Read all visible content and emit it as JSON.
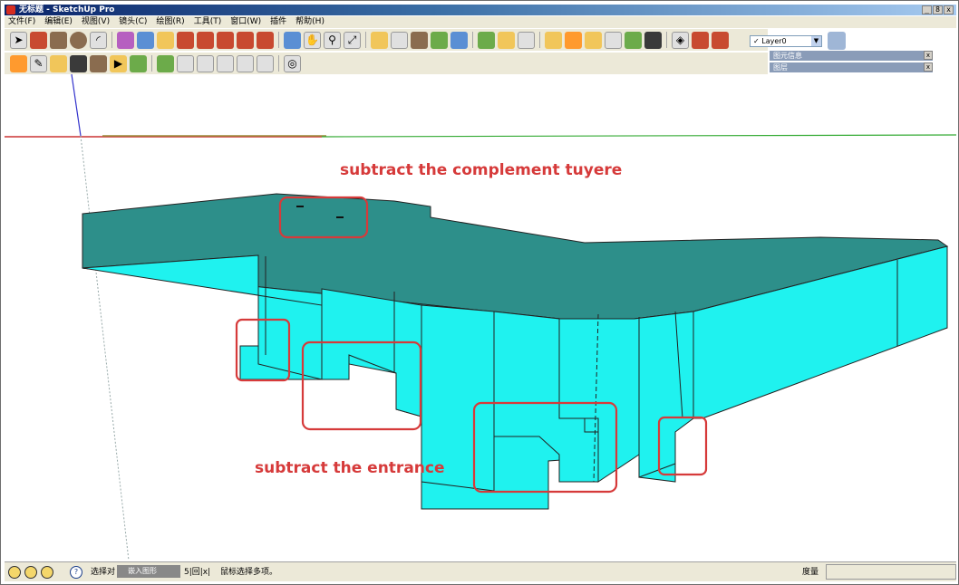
{
  "window": {
    "title": "无标题 - SketchUp Pro",
    "controls": [
      "_",
      "8",
      "x"
    ]
  },
  "menubar": {
    "items": [
      "文件(F)",
      "编辑(E)",
      "视图(V)",
      "镜头(C)",
      "绘图(R)",
      "工具(T)",
      "窗口(W)",
      "插件",
      "帮助(H)"
    ]
  },
  "toolbar1": {
    "icons": [
      "select-icon",
      "pencil-icon",
      "rectangle-icon",
      "circle-icon",
      "arc-icon",
      "eraser-icon",
      "paint-bucket-icon",
      "tape-measure-icon",
      "protractor-icon",
      "push-pull-icon",
      "move-icon",
      "rotate-icon",
      "follow-me-icon",
      "orbit-icon",
      "pan-icon",
      "zoom-icon",
      "zoom-extents-icon",
      "camera-icon",
      "position-camera-icon",
      "walk-icon",
      "look-around-icon",
      "section-plane-icon",
      "components-icon",
      "materials-icon",
      "styles-icon",
      "dimension-icon",
      "text-icon",
      "axes-icon",
      "3d-text-icon",
      "layers-icon",
      "outliner-icon",
      "scenes-icon"
    ]
  },
  "toolbar2": {
    "icons": [
      "xray-icon",
      "back-edges-icon",
      "wireframe-icon",
      "hidden-line-icon",
      "shaded-icon",
      "shaded-textures-icon",
      "monochrome-icon",
      "iso-view-icon",
      "top-view-icon",
      "front-view-icon",
      "right-view-icon",
      "back-view-icon",
      "left-view-icon",
      "bottom-view-icon"
    ]
  },
  "layer": {
    "current": "Layer0",
    "checked": "✓"
  },
  "trays": {
    "entity_info": "图元信息",
    "layers": "图层"
  },
  "annotations": {
    "tuyere": "subtract the complement tuyere",
    "entrance": "subtract the entrance"
  },
  "statusbar": {
    "help_icon": "?",
    "select_prefix": "选择对",
    "ime_label": "嵌入图形",
    "ime_buttons": "5|回|x|",
    "hint": "鼠标选择多项。",
    "measure_label": "度量"
  },
  "colors": {
    "model_side": "#1ff2ef",
    "model_top": "#2d8f8a",
    "annotation": "#d63a3a",
    "axis_red": "#cc3333",
    "axis_green": "#33aa33",
    "axis_blue": "#3333cc"
  }
}
